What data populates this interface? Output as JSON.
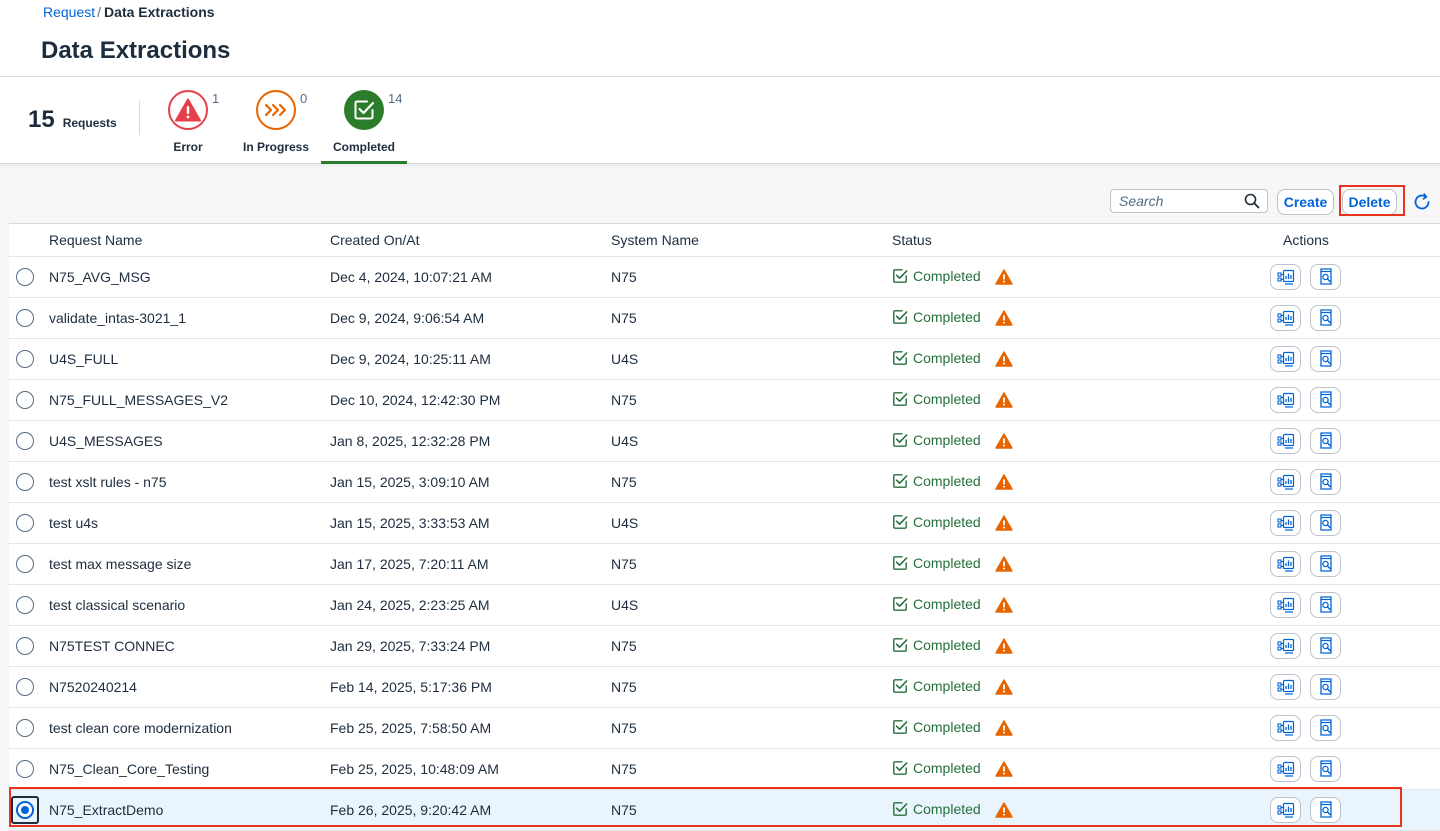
{
  "breadcrumb": {
    "parent": "Request",
    "separator": "/",
    "current": "Data Extractions"
  },
  "page": {
    "title": "Data Extractions"
  },
  "summary": {
    "total": "15",
    "total_label": "Requests"
  },
  "tabs": [
    {
      "key": "error",
      "label": "Error",
      "count": "1",
      "icon": "warning-icon",
      "color": "#e4414b"
    },
    {
      "key": "in_progress",
      "label": "In Progress",
      "count": "0",
      "icon": "fast-forward-icon",
      "color": "#e76500"
    },
    {
      "key": "completed",
      "label": "Completed",
      "count": "14",
      "icon": "checkbox-checked-icon",
      "color": "#2b7d2b",
      "selected": true
    }
  ],
  "toolbar": {
    "search_placeholder": "Search",
    "create_label": "Create",
    "delete_label": "Delete"
  },
  "table": {
    "columns": [
      "Request Name",
      "Created On/At",
      "System Name",
      "Status",
      "Actions"
    ],
    "rows": [
      {
        "name": "N75_AVG_MSG",
        "created": "Dec 4, 2024, 10:07:21 AM",
        "system": "N75",
        "status": "Completed"
      },
      {
        "name": "validate_intas-3021_1",
        "created": "Dec 9, 2024, 9:06:54 AM",
        "system": "N75",
        "status": "Completed"
      },
      {
        "name": "U4S_FULL",
        "created": "Dec 9, 2024, 10:25:11 AM",
        "system": "U4S",
        "status": "Completed"
      },
      {
        "name": "N75_FULL_MESSAGES_V2",
        "created": "Dec 10, 2024, 12:42:30 PM",
        "system": "N75",
        "status": "Completed"
      },
      {
        "name": "U4S_MESSAGES",
        "created": "Jan 8, 2025, 12:32:28 PM",
        "system": "U4S",
        "status": "Completed"
      },
      {
        "name": "test xslt rules - n75",
        "created": "Jan 15, 2025, 3:09:10 AM",
        "system": "N75",
        "status": "Completed"
      },
      {
        "name": "test u4s",
        "created": "Jan 15, 2025, 3:33:53 AM",
        "system": "U4S",
        "status": "Completed"
      },
      {
        "name": "test max message size",
        "created": "Jan 17, 2025, 7:20:11 AM",
        "system": "N75",
        "status": "Completed"
      },
      {
        "name": "test classical scenario",
        "created": "Jan 24, 2025, 2:23:25 AM",
        "system": "U4S",
        "status": "Completed"
      },
      {
        "name": "N75TEST CONNEC",
        "created": "Jan 29, 2025, 7:33:24 PM",
        "system": "N75",
        "status": "Completed"
      },
      {
        "name": "N7520240214",
        "created": "Feb 14, 2025, 5:17:36 PM",
        "system": "N75",
        "status": "Completed"
      },
      {
        "name": "test clean core modernization",
        "created": "Feb 25, 2025, 7:58:50 AM",
        "system": "N75",
        "status": "Completed"
      },
      {
        "name": "N75_Clean_Core_Testing",
        "created": "Feb 25, 2025, 10:48:09 AM",
        "system": "N75",
        "status": "Completed"
      },
      {
        "name": "N75_ExtractDemo",
        "created": "Feb 26, 2025, 9:20:42 AM",
        "system": "N75",
        "status": "Completed",
        "selected": true
      }
    ]
  },
  "colors": {
    "link": "#0064d9",
    "success": "#256f3a",
    "warning": "#e76500",
    "error": "#e4414b",
    "highlight": "#e8331f"
  }
}
